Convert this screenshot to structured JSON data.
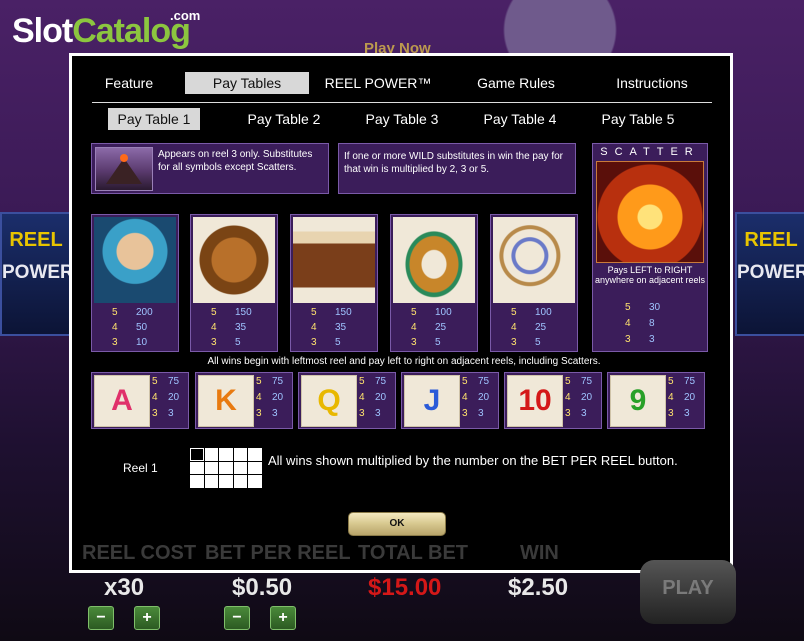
{
  "brand": {
    "logo_part1": "Slot",
    "logo_part2": "Catalog",
    "logo_com": ".com"
  },
  "background": {
    "play_now": "Play Now"
  },
  "side_panels": {
    "title": "REEL",
    "subtitle": "POWER"
  },
  "tabs": {
    "items": [
      "Feature",
      "Pay Tables",
      "REEL POWER™",
      "Game Rules",
      "Instructions"
    ],
    "active": "Pay Tables"
  },
  "subtabs": {
    "items": [
      "Pay Table 1",
      "Pay Table 2",
      "Pay Table 3",
      "Pay Table 4",
      "Pay Table 5"
    ],
    "active": "Pay Table 1"
  },
  "wild": {
    "text": "Appears on reel 3 only. Substitutes for all symbols except Scatters."
  },
  "multiplier": {
    "text": "If one or more WILD substitutes in win the pay for that win is multiplied by 2, 3 or 5."
  },
  "scatter": {
    "title": "SCATTER",
    "desc": "Pays LEFT to RIGHT anywhere on adjacent reels",
    "pays": [
      {
        "count": "5",
        "value": "30"
      },
      {
        "count": "4",
        "value": "8"
      },
      {
        "count": "3",
        "value": "3"
      }
    ]
  },
  "symbols": [
    {
      "icon": "aztec-warrior-icon",
      "pays": [
        {
          "count": "5",
          "value": "200"
        },
        {
          "count": "4",
          "value": "50"
        },
        {
          "count": "3",
          "value": "10"
        }
      ]
    },
    {
      "icon": "golden-idol-icon",
      "pays": [
        {
          "count": "5",
          "value": "150"
        },
        {
          "count": "4",
          "value": "35"
        },
        {
          "count": "3",
          "value": "5"
        }
      ]
    },
    {
      "icon": "drum-icon",
      "pays": [
        {
          "count": "5",
          "value": "150"
        },
        {
          "count": "4",
          "value": "35"
        },
        {
          "count": "3",
          "value": "5"
        }
      ]
    },
    {
      "icon": "bracelet-icon",
      "pays": [
        {
          "count": "5",
          "value": "100"
        },
        {
          "count": "4",
          "value": "25"
        },
        {
          "count": "3",
          "value": "5"
        }
      ]
    },
    {
      "icon": "amulet-icon",
      "pays": [
        {
          "count": "5",
          "value": "100"
        },
        {
          "count": "4",
          "value": "25"
        },
        {
          "count": "3",
          "value": "5"
        }
      ]
    }
  ],
  "all_wins_text": "All wins begin with leftmost reel and pay left to right on adjacent reels, including Scatters.",
  "cards": [
    {
      "label": "A",
      "color": "#e0306a",
      "pays": [
        {
          "count": "5",
          "value": "75"
        },
        {
          "count": "4",
          "value": "20"
        },
        {
          "count": "3",
          "value": "3"
        }
      ]
    },
    {
      "label": "K",
      "color": "#e87a10",
      "pays": [
        {
          "count": "5",
          "value": "75"
        },
        {
          "count": "4",
          "value": "20"
        },
        {
          "count": "3",
          "value": "3"
        }
      ]
    },
    {
      "label": "Q",
      "color": "#e8b800",
      "pays": [
        {
          "count": "5",
          "value": "75"
        },
        {
          "count": "4",
          "value": "20"
        },
        {
          "count": "3",
          "value": "3"
        }
      ]
    },
    {
      "label": "J",
      "color": "#2a5ad8",
      "pays": [
        {
          "count": "5",
          "value": "75"
        },
        {
          "count": "4",
          "value": "20"
        },
        {
          "count": "3",
          "value": "3"
        }
      ]
    },
    {
      "label": "10",
      "color": "#d41818",
      "pays": [
        {
          "count": "5",
          "value": "75"
        },
        {
          "count": "4",
          "value": "20"
        },
        {
          "count": "3",
          "value": "3"
        }
      ]
    },
    {
      "label": "9",
      "color": "#28a028",
      "pays": [
        {
          "count": "5",
          "value": "75"
        },
        {
          "count": "4",
          "value": "20"
        },
        {
          "count": "3",
          "value": "3"
        }
      ]
    }
  ],
  "reel_label": "Reel 1",
  "multiplied_note": "All wins shown multiplied by the number on the BET PER REEL button.",
  "ok_label": "OK",
  "bottom": {
    "reel_cost_label": "REEL COST",
    "bet_per_reel_label": "BET PER REEL",
    "total_bet_label": "TOTAL BET",
    "win_label": "WIN",
    "reel_cost_value": "x30",
    "bet_per_reel_value": "$0.50",
    "total_bet_value": "$15.00",
    "win_value": "$2.50",
    "play_label": "PLAY",
    "minus": "−",
    "plus": "+"
  }
}
